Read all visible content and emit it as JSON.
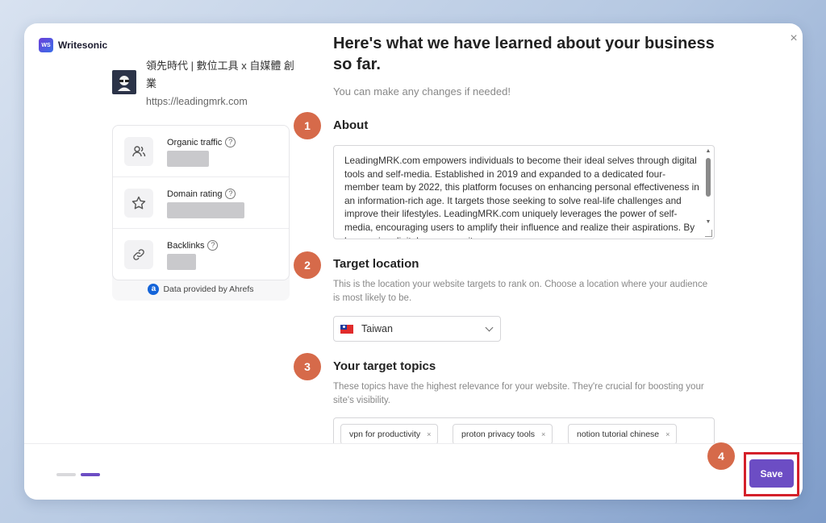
{
  "brand": {
    "logo_text": "WS",
    "name": "Writesonic"
  },
  "site": {
    "name": "領先時代 | 數位工具 x 自媒體 創業",
    "url": "https://leadingmrk.com"
  },
  "metrics": {
    "items": [
      {
        "label": "Organic traffic",
        "icon": "users-icon"
      },
      {
        "label": "Domain rating",
        "icon": "star-icon"
      },
      {
        "label": "Backlinks",
        "icon": "link-icon"
      }
    ],
    "help_glyph": "?",
    "ahrefs_logo": "a",
    "ahrefs_note": "Data provided by Ahrefs"
  },
  "header": {
    "title": "Here's what we have learned about your business so far.",
    "subtitle": "You can make any changes if needed!"
  },
  "steps": {
    "about": {
      "number": "1",
      "title": "About"
    },
    "location": {
      "number": "2",
      "title": "Target location",
      "description": "This is the location your website targets to rank on. Choose a location where your audience is most likely to be."
    },
    "topics": {
      "number": "3",
      "title": "Your target topics",
      "description": "These topics have the highest relevance for your website. They're crucial for boosting your site's visibility."
    },
    "save": {
      "number": "4"
    }
  },
  "about_text": "LeadingMRK.com empowers individuals to become their ideal selves through digital tools and self-media. Established in 2019 and expanded to a dedicated four-member team by 2022, this platform focuses on enhancing personal effectiveness in an information-rich age. It targets those seeking to solve real-life challenges and improve their lifestyles. LeadingMRK.com uniquely leverages the power of self-media, encouraging users to amplify their influence and realize their aspirations. By harnessing digital resources, it",
  "location": {
    "selected": "Taiwan"
  },
  "topics": [
    "vpn for productivity",
    "proton privacy tools",
    "notion tutorial chinese"
  ],
  "chip_remove_glyph": "×",
  "close_glyph": "×",
  "footer": {
    "save_label": "Save"
  },
  "colors": {
    "accent": "#6c4dc4",
    "step_badge": "#d66a4a",
    "highlight": "#d4202a",
    "progress_inactive": "#d9d9dc",
    "progress_active": "#6c4dc4"
  }
}
